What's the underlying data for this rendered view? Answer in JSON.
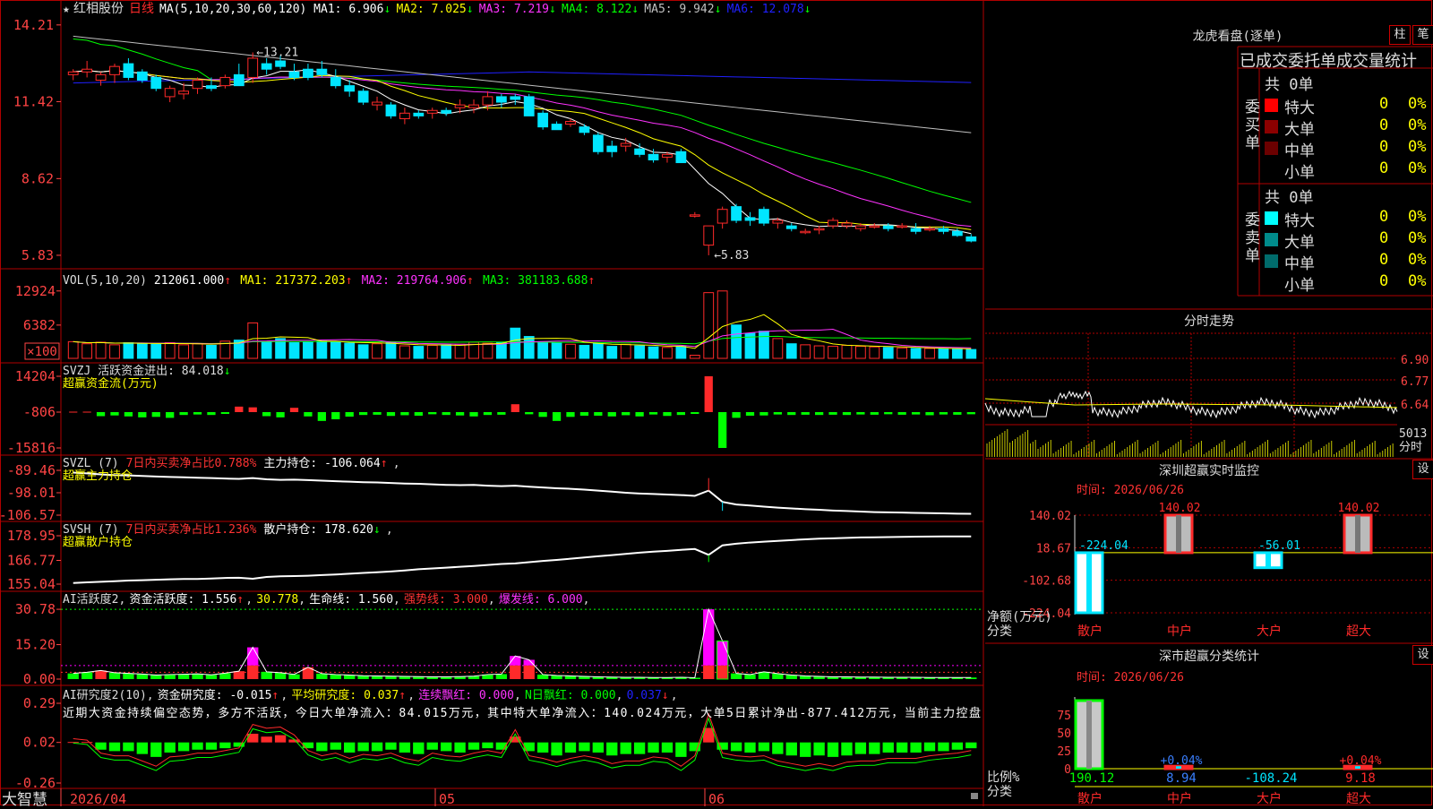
{
  "colors": {
    "up": "#ff2a2a",
    "down": "#00e5ff",
    "grid": "#b00000",
    "axisText": "#ff4444",
    "ma1": "#ffffff",
    "ma2": "#ffff00",
    "ma3": "#ff33ff",
    "ma4": "#00ff00",
    "ma5": "#c0c0c0",
    "ma6": "#2020ff",
    "green": "#00ff00",
    "magenta": "#ff00ff"
  },
  "main": {
    "star": "★",
    "stock_name": "红相股份",
    "period": "日线",
    "legend": [
      {
        "label": "MA(5,10,20,30,60,120)  MA1: 6.906",
        "arrow": "↓",
        "color": "#ffffff"
      },
      {
        "label": "MA2: 7.025",
        "arrow": "↓",
        "color": "#ffff00"
      },
      {
        "label": "MA3: 7.219",
        "arrow": "↓",
        "color": "#ff33ff"
      },
      {
        "label": "MA4: 8.122",
        "arrow": "↓",
        "color": "#00ff00"
      },
      {
        "label": "MA5: 9.942",
        "arrow": "↓",
        "color": "#c0c0c0"
      },
      {
        "label": "MA6: 12.078",
        "arrow": "↓",
        "color": "#2020ff"
      }
    ],
    "yticks": [
      "14.21",
      "11.42",
      "8.62",
      "5.83"
    ],
    "high_label": "←13.21",
    "low_label": "←5.83"
  },
  "vol": {
    "legend": [
      {
        "label": "VOL(5,10,20)",
        "color": "#dddddd"
      },
      {
        "label": "212061.000",
        "color": "#ffffff",
        "arrow": "↑"
      },
      {
        "label": "MA1: 217372.203",
        "color": "#ffff00",
        "arrow": "↑"
      },
      {
        "label": "MA2: 219764.906",
        "color": "#ff33ff",
        "arrow": "↑"
      },
      {
        "label": "MA3: 381183.688",
        "color": "#00ff00",
        "arrow": "↑"
      }
    ],
    "yticks": [
      "12924",
      "6382",
      "×100"
    ]
  },
  "svzj": {
    "legend1": "SVZJ  活跃资金进出: 84.018",
    "arrow": "↓",
    "legend2": "超赢资金流(万元)",
    "yticks": [
      "14204",
      "-806",
      "-15816"
    ]
  },
  "svzl": {
    "legend": [
      {
        "label": "SVZL (7)",
        "color": "#dddddd"
      },
      {
        "label": "7日内买卖净占比0.788%",
        "color": "#ff3333"
      },
      {
        "label": "主力持仓: -106.064",
        "color": "#ffffff",
        "arrow": "↑"
      }
    ],
    "legend2": "超赢主力持仓",
    "yticks": [
      "-89.46",
      "-98.01",
      "-106.57"
    ]
  },
  "svsh": {
    "legend": [
      {
        "label": "SVSH (7)",
        "color": "#dddddd"
      },
      {
        "label": "7日内买卖净占比1.236%",
        "color": "#ff3333"
      },
      {
        "label": "散户持仓: 178.620",
        "color": "#ffffff",
        "arrow": "↓"
      }
    ],
    "legend2": "超赢散户持仓",
    "yticks": [
      "178.95",
      "166.77",
      "155.04"
    ]
  },
  "ai1": {
    "legend": [
      {
        "label": "AI活跃度2",
        "color": "#dddddd"
      },
      {
        "label": "资金活跃度: 1.556",
        "color": "#ffffff",
        "arrow": "↑"
      },
      {
        "label": "30.778",
        "color": "#ffff00"
      },
      {
        "label": "生命线: 1.560",
        "color": "#ffffff"
      },
      {
        "label": "强势线: 3.000",
        "color": "#ff3333"
      },
      {
        "label": "爆发线: 6.000",
        "color": "#ff33ff"
      }
    ],
    "yticks": [
      "30.78",
      "15.20",
      "0.00"
    ]
  },
  "ai2": {
    "legend": [
      {
        "label": "AI研究度2(10)",
        "color": "#dddddd"
      },
      {
        "label": "资金研究度: -0.015",
        "color": "#ffffff",
        "arrow": "↑"
      },
      {
        "label": "平均研究度: 0.037",
        "color": "#ffff00",
        "arrow": "↑"
      },
      {
        "label": "连续飘红: 0.000",
        "color": "#ff33ff"
      },
      {
        "label": "N日飘红: 0.000",
        "color": "#00ff00"
      },
      {
        "label": "0.037",
        "color": "#2020ff",
        "arrow": "↓"
      }
    ],
    "commentary": "近期大资金持续偏空态势，多方不活跃，今日大单净流入：84.015万元，其中特大单净流入：140.024万元，大单5日累计净出-877.412万元，当前主力控盘",
    "yticks": [
      "0.29",
      "0.02",
      "-0.26"
    ]
  },
  "xaxis": {
    "logo": "大智慧",
    "labels": [
      "2026/04",
      "05",
      "06"
    ]
  },
  "longhu": {
    "title": "龙虎看盘(逐单)",
    "btn_bar": "柱",
    "btn_pen": "笔",
    "tabs": [
      "已成交",
      "委托单",
      "成交量统计"
    ],
    "buy": {
      "vertical": "委买单",
      "total": "共 0单",
      "rows": [
        {
          "name": "特大",
          "v": "0",
          "p": "0%",
          "c": "#ff0000"
        },
        {
          "name": "大单",
          "v": "0",
          "p": "0%",
          "c": "#8b0000"
        },
        {
          "name": "中单",
          "v": "0",
          "p": "0%",
          "c": "#6b0000"
        },
        {
          "name": "小单",
          "v": "0",
          "p": "0%",
          "c": "#000000"
        }
      ]
    },
    "sell": {
      "vertical": "委卖单",
      "total": "共 0单",
      "rows": [
        {
          "name": "特大",
          "v": "0",
          "p": "0%",
          "c": "#00ffff"
        },
        {
          "name": "大单",
          "v": "0",
          "p": "0%",
          "c": "#008b8b"
        },
        {
          "name": "中单",
          "v": "0",
          "p": "0%",
          "c": "#006b6b"
        },
        {
          "name": "小单",
          "v": "0",
          "p": "0%",
          "c": "#000000"
        }
      ]
    }
  },
  "fenshi": {
    "title": "分时走势",
    "yticks": [
      "6.90",
      "6.77",
      "6.64"
    ],
    "vol_label": "5013",
    "tag": "分时"
  },
  "monitor": {
    "title": "深圳超赢实时监控",
    "set": "设",
    "time": "时间: 2026/06/26",
    "yticks": [
      "140.02",
      "18.67",
      "-102.68",
      "-224.04"
    ],
    "ylabel": "净额(万元)",
    "xlabel": "分类",
    "categories": [
      "散户",
      "中户",
      "大户",
      "超大"
    ],
    "values": [
      -224.04,
      140.02,
      -56.01,
      140.02
    ],
    "value_labels": [
      "-224.04",
      "140.02",
      "-56.01",
      "140.02"
    ]
  },
  "classify": {
    "title": "深市超赢分类统计",
    "set": "设",
    "time": "时间: 2026/06/26",
    "yticks": [
      "75",
      "50",
      "25",
      "0"
    ],
    "ylabel": "比例%",
    "xlabel": "分类",
    "categories": [
      "散户",
      "中户",
      "大户",
      "超大"
    ],
    "bar_pct": [
      95,
      3.5,
      0,
      3.5
    ],
    "pct_labels": [
      "",
      "+0.04%",
      "",
      "+0.04%"
    ],
    "values": [
      "190.12",
      "8.94",
      "-108.24",
      "9.18"
    ]
  },
  "chart_data": [
    {
      "type": "candlestick",
      "title": "红相股份 日线",
      "x": [
        "2026/04",
        "05",
        "06"
      ],
      "ohlc": [
        [
          12.4,
          12.6,
          12.2,
          12.5
        ],
        [
          12.5,
          12.9,
          12.3,
          12.6
        ],
        [
          12.2,
          12.5,
          12.0,
          12.4
        ],
        [
          12.4,
          12.8,
          12.1,
          12.7
        ],
        [
          12.8,
          13.0,
          12.2,
          12.3
        ],
        [
          12.5,
          12.6,
          12.1,
          12.2
        ],
        [
          12.3,
          12.4,
          11.8,
          11.9
        ],
        [
          11.6,
          12.0,
          11.4,
          11.9
        ],
        [
          11.7,
          12.1,
          11.5,
          11.8
        ],
        [
          11.9,
          12.3,
          11.7,
          12.2
        ],
        [
          12.0,
          12.3,
          11.8,
          11.9
        ],
        [
          12.0,
          12.4,
          11.9,
          12.3
        ],
        [
          12.4,
          12.8,
          12.0,
          12.0
        ],
        [
          12.3,
          13.21,
          12.1,
          13.0
        ],
        [
          12.8,
          13.0,
          12.4,
          12.6
        ],
        [
          12.9,
          13.1,
          12.6,
          12.7
        ],
        [
          12.5,
          12.8,
          12.2,
          12.3
        ],
        [
          12.6,
          12.8,
          12.2,
          12.3
        ],
        [
          12.6,
          12.9,
          12.3,
          12.4
        ],
        [
          12.3,
          12.6,
          11.9,
          12.0
        ],
        [
          12.0,
          12.2,
          11.6,
          11.8
        ],
        [
          11.8,
          11.9,
          11.3,
          11.4
        ],
        [
          11.3,
          11.6,
          11.1,
          11.4
        ],
        [
          11.3,
          11.4,
          10.8,
          10.9
        ],
        [
          10.8,
          11.2,
          10.6,
          11.0
        ],
        [
          11.0,
          11.1,
          10.8,
          10.9
        ],
        [
          11.0,
          11.2,
          10.8,
          11.1
        ],
        [
          11.1,
          11.2,
          10.9,
          11.0
        ],
        [
          11.2,
          11.5,
          11.0,
          11.3
        ],
        [
          11.2,
          11.5,
          11.0,
          11.3
        ],
        [
          11.3,
          11.8,
          11.1,
          11.6
        ],
        [
          11.6,
          11.7,
          11.2,
          11.4
        ],
        [
          11.6,
          11.7,
          11.3,
          11.5
        ],
        [
          11.6,
          11.7,
          10.9,
          10.9
        ],
        [
          11.0,
          11.1,
          10.4,
          10.5
        ],
        [
          10.6,
          10.7,
          10.4,
          10.4
        ],
        [
          10.6,
          10.8,
          10.5,
          10.7
        ],
        [
          10.5,
          10.6,
          10.2,
          10.3
        ],
        [
          10.2,
          10.3,
          9.5,
          9.6
        ],
        [
          9.8,
          10.0,
          9.4,
          9.6
        ],
        [
          9.8,
          10.1,
          9.6,
          9.9
        ],
        [
          9.7,
          9.9,
          9.4,
          9.5
        ],
        [
          9.5,
          9.7,
          9.2,
          9.3
        ],
        [
          9.4,
          9.6,
          9.2,
          9.5
        ],
        [
          9.6,
          9.7,
          9.2,
          9.2
        ],
        [
          7.3,
          7.4,
          7.2,
          7.3
        ],
        [
          6.2,
          6.9,
          5.83,
          6.9
        ],
        [
          7.0,
          7.6,
          6.8,
          7.5
        ],
        [
          7.6,
          7.7,
          7.0,
          7.1
        ],
        [
          7.2,
          7.4,
          6.9,
          7.1
        ],
        [
          7.5,
          7.6,
          6.9,
          7.0
        ],
        [
          7.0,
          7.2,
          6.8,
          7.1
        ],
        [
          6.9,
          7.0,
          6.7,
          6.8
        ],
        [
          6.7,
          6.8,
          6.6,
          6.7
        ],
        [
          6.8,
          6.9,
          6.6,
          6.8
        ],
        [
          6.9,
          7.2,
          6.8,
          7.1
        ],
        [
          6.9,
          7.1,
          6.8,
          7.0
        ],
        [
          6.8,
          7.0,
          6.7,
          6.9
        ],
        [
          6.9,
          7.0,
          6.8,
          6.9
        ],
        [
          6.9,
          7.0,
          6.7,
          6.8
        ],
        [
          6.9,
          7.0,
          6.8,
          6.9
        ],
        [
          6.8,
          7.0,
          6.6,
          6.7
        ],
        [
          6.8,
          6.9,
          6.7,
          6.8
        ],
        [
          6.8,
          6.9,
          6.6,
          6.7
        ],
        [
          6.7,
          6.8,
          6.5,
          6.55
        ],
        [
          6.5,
          6.6,
          6.3,
          6.35
        ]
      ],
      "ylim": [
        5.6,
        14.4
      ]
    },
    {
      "type": "bar",
      "title": "VOL",
      "values": [
        3200,
        2800,
        3100,
        2600,
        3000,
        2900,
        2700,
        3000,
        2600,
        2800,
        2500,
        3300,
        3500,
        6800,
        3200,
        3800,
        3000,
        3100,
        3300,
        3200,
        2900,
        2600,
        2800,
        3000,
        2400,
        2300,
        2500,
        2600,
        2700,
        3100,
        2900,
        3000,
        5800,
        4200,
        3200,
        3000,
        2700,
        2500,
        3000,
        2300,
        2700,
        2400,
        2200,
        2100,
        2300,
        600,
        12600,
        12924,
        6400,
        4800,
        5200,
        3800,
        2800,
        2600,
        2400,
        2300,
        2500,
        2300,
        2200,
        2100,
        2000,
        1900,
        1900,
        1800,
        1800,
        1700
      ],
      "ylim": [
        0,
        13400
      ]
    },
    {
      "type": "bar",
      "title": "SVZJ",
      "values": [
        -806,
        -806,
        -2500,
        -2200,
        -2600,
        -3000,
        -2800,
        -3200,
        -2000,
        -1800,
        -2000,
        -1500,
        1500,
        1200,
        -2500,
        -3000,
        1000,
        -2600,
        -4500,
        -3800,
        -2700,
        -2000,
        -1900,
        -2400,
        -2100,
        -2300,
        -1700,
        -2000,
        -2200,
        -2600,
        -2000,
        -1900,
        2500,
        -1700,
        -2800,
        -4500,
        -2800,
        -2300,
        -2300,
        -2600,
        -2100,
        -2600,
        -1800,
        -2400,
        -2000,
        -1500,
        14204,
        -15816,
        -3200,
        -2300,
        -2200,
        -1800,
        -2000,
        -1900,
        -2000,
        -1900,
        -2000,
        -1800,
        -1900,
        -1700,
        -1900,
        -1800,
        -2100,
        -1800,
        -1900,
        -1700
      ],
      "ylim": [
        -15816,
        14204
      ]
    },
    {
      "type": "line",
      "title": "SVZL 主力持仓",
      "values": [
        -90.3,
        -90.6,
        -91.0,
        -91.3,
        -91.4,
        -91.6,
        -91.8,
        -92.0,
        -92.1,
        -92.3,
        -92.4,
        -92.6,
        -92.7,
        -92.4,
        -92.9,
        -93.1,
        -93.0,
        -93.2,
        -93.4,
        -93.6,
        -93.8,
        -94.0,
        -94.1,
        -94.3,
        -94.5,
        -94.6,
        -94.8,
        -95.0,
        -95.1,
        -95.0,
        -95.3,
        -95.5,
        -95.3,
        -95.7,
        -96.0,
        -96.3,
        -96.5,
        -96.8,
        -97.2,
        -97.6,
        -98.0,
        -98.3,
        -98.5,
        -98.7,
        -98.9,
        -99.2,
        -97.2,
        -101.5,
        -102.5,
        -102.9,
        -103.3,
        -103.7,
        -104.0,
        -104.3,
        -104.5,
        -104.8,
        -105.0,
        -105.2,
        -105.4,
        -105.5,
        -105.6,
        -105.7,
        -105.8,
        -105.9,
        -106.0,
        -106.06
      ],
      "ylim": [
        -106.57,
        -89.46
      ]
    },
    {
      "type": "line",
      "title": "SVSH 散户持仓",
      "values": [
        155.6,
        155.9,
        156.2,
        156.5,
        156.8,
        157.0,
        157.2,
        157.4,
        157.6,
        157.6,
        157.8,
        158.1,
        158.2,
        157.7,
        158.6,
        158.9,
        159.0,
        159.2,
        159.5,
        159.8,
        160.2,
        160.6,
        160.9,
        161.3,
        161.8,
        162.4,
        162.8,
        163.2,
        163.6,
        164.0,
        164.5,
        165.0,
        165.3,
        165.9,
        166.5,
        167.0,
        167.6,
        168.2,
        168.8,
        169.4,
        170.0,
        170.6,
        171.1,
        171.5,
        172.0,
        172.4,
        169.5,
        174.2,
        175.0,
        175.6,
        176.0,
        176.4,
        176.8,
        177.2,
        177.5,
        177.7,
        177.9,
        178.1,
        178.2,
        178.3,
        178.4,
        178.5,
        178.55,
        178.6,
        178.6,
        178.62
      ],
      "ylim": [
        155.04,
        178.95
      ]
    },
    {
      "type": "bar",
      "title": "AI活跃度2",
      "values": [
        2.5,
        3.0,
        3.8,
        2.8,
        2.5,
        2.2,
        1.8,
        2.0,
        2.1,
        2.3,
        1.9,
        2.6,
        3.5,
        14.0,
        3.2,
        2.8,
        2.1,
        5.2,
        2.4,
        2.0,
        1.8,
        1.5,
        1.4,
        1.3,
        1.2,
        1.1,
        1.0,
        1.0,
        1.1,
        1.3,
        2.0,
        2.2,
        10.2,
        8.5,
        2.0,
        1.6,
        1.4,
        1.2,
        1.0,
        0.9,
        0.8,
        0.8,
        0.7,
        0.7,
        0.8,
        0.6,
        30.78,
        16.8,
        2.5,
        2.0,
        3.2,
        2.4,
        1.8,
        1.4,
        1.2,
        1.0,
        1.0,
        0.9,
        0.9,
        0.8,
        0.8,
        0.8,
        0.7,
        0.7,
        0.7,
        0.7
      ],
      "ylim": [
        0,
        32
      ]
    },
    {
      "type": "bar",
      "title": "AI研究度2(10)",
      "values": [
        0.02,
        0.02,
        -0.03,
        -0.04,
        -0.04,
        -0.06,
        -0.08,
        -0.05,
        -0.04,
        -0.03,
        -0.03,
        -0.02,
        -0.01,
        0.08,
        0.06,
        0.07,
        0.04,
        -0.02,
        -0.04,
        -0.03,
        -0.05,
        -0.04,
        -0.04,
        -0.03,
        -0.05,
        -0.06,
        -0.03,
        -0.04,
        -0.05,
        -0.03,
        -0.02,
        -0.03,
        0.06,
        -0.04,
        -0.05,
        -0.07,
        -0.05,
        -0.04,
        -0.05,
        -0.07,
        -0.06,
        -0.06,
        -0.05,
        -0.05,
        -0.08,
        -0.04,
        0.12,
        -0.03,
        -0.04,
        -0.05,
        -0.04,
        -0.06,
        -0.07,
        -0.08,
        -0.07,
        -0.08,
        -0.07,
        -0.06,
        -0.06,
        -0.05,
        -0.05,
        -0.05,
        -0.04,
        -0.04,
        -0.03,
        -0.02
      ],
      "ylim": [
        -0.26,
        0.29
      ]
    }
  ]
}
